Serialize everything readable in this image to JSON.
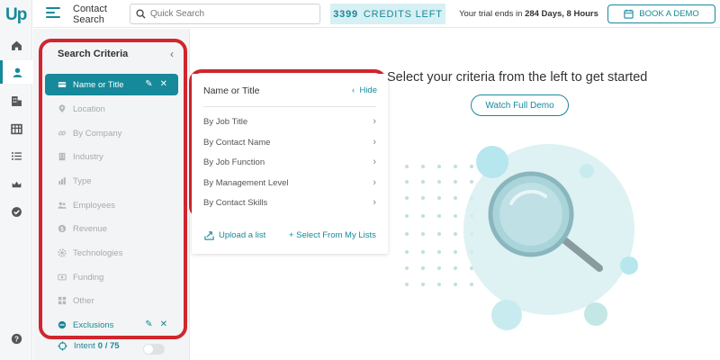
{
  "app": {
    "logo": "Up"
  },
  "rail": {
    "items": [
      {
        "icon": "home-icon",
        "active": false
      },
      {
        "icon": "contact-icon",
        "active": true
      },
      {
        "icon": "company-building-icon",
        "active": false
      },
      {
        "icon": "table-grid-icon",
        "active": false
      },
      {
        "icon": "list-icon",
        "active": false
      },
      {
        "icon": "crown-icon",
        "active": false
      },
      {
        "icon": "check-circle-icon",
        "active": false
      }
    ],
    "help_icon": "question-circle-icon"
  },
  "header": {
    "title_line1": "Contact",
    "title_line2": "Search",
    "search_placeholder": "Quick Search",
    "credits_number": "3399",
    "credits_label": "CREDITS LEFT",
    "trial_prefix": "Your trial ends in",
    "trial_value": "284 Days, 8 Hours",
    "book_demo": "BOOK A DEMO"
  },
  "criteria": {
    "title": "Search Criteria",
    "collapse": "‹",
    "items": [
      {
        "label": "Name or Title",
        "icon": "id-card-icon"
      },
      {
        "label": "Location",
        "icon": "map-pin-icon"
      },
      {
        "label": "By Company",
        "icon": "link-icon"
      },
      {
        "label": "Industry",
        "icon": "building-icon"
      },
      {
        "label": "Type",
        "icon": "bar-chart-icon"
      },
      {
        "label": "Employees",
        "icon": "people-icon"
      },
      {
        "label": "Revenue",
        "icon": "dollar-icon"
      },
      {
        "label": "Technologies",
        "icon": "gear-icon"
      },
      {
        "label": "Funding",
        "icon": "funding-icon"
      },
      {
        "label": "Other",
        "icon": "grid-icon"
      }
    ],
    "exclusions": "Exclusions",
    "intent_label": "Intent",
    "intent_value": "0 / 75"
  },
  "submenu": {
    "title": "Name or Title",
    "hide": "Hide",
    "items": [
      "By Job Title",
      "By Contact Name",
      "By Job Function",
      "By Management Level",
      "By Contact Skills"
    ],
    "upload": "Upload a list",
    "select_lists": "+ Select From My Lists"
  },
  "main": {
    "prompt": "Select your criteria from the left to get started",
    "watch_demo": "Watch Full Demo"
  },
  "colors": {
    "accent": "#16899a",
    "highlight_outline": "#d0262e",
    "illustration_light": "#d6eff0",
    "illustration_bubble": "#b6e6ee"
  }
}
